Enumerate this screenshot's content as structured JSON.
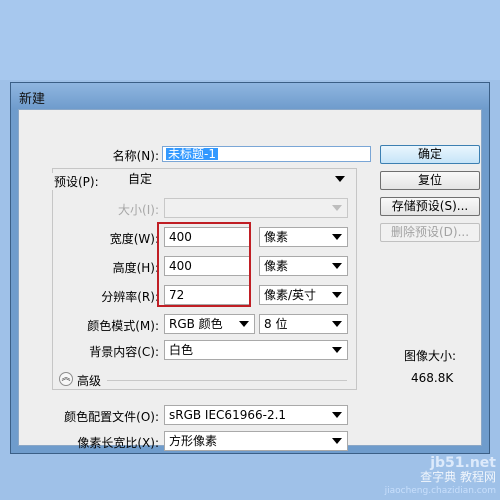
{
  "dialog": {
    "title": "新建",
    "name_label": "名称(N):",
    "name_value": "未标题-1",
    "preset_label": "预设(P):",
    "preset_value": "自定",
    "size_label": "大小(I):",
    "width_label": "宽度(W):",
    "width_value": "400",
    "width_unit": "像素",
    "height_label": "高度(H):",
    "height_value": "400",
    "height_unit": "像素",
    "resolution_label": "分辨率(R):",
    "resolution_value": "72",
    "resolution_unit": "像素/英寸",
    "color_mode_label": "颜色模式(M):",
    "color_mode_value": "RGB 颜色",
    "bit_depth_value": "8 位",
    "background_label": "背景内容(C):",
    "background_value": "白色",
    "advanced_label": "高级",
    "color_profile_label": "颜色配置文件(O):",
    "color_profile_value": "sRGB IEC61966-2.1",
    "pixel_aspect_label": "像素长宽比(X):",
    "pixel_aspect_value": "方形像素"
  },
  "buttons": {
    "ok": "确定",
    "reset": "复位",
    "save_preset": "存储预设(S)...",
    "delete_preset": "删除预设(D)..."
  },
  "image_size": {
    "label": "图像大小:",
    "value": "468.8K"
  },
  "watermark": {
    "line1": "jb51.net",
    "line2": "查字典 教程网",
    "line3": "jiaocheng.chazidian.com"
  },
  "colors": {
    "ok_button": "#c6e4f8",
    "highlight_box": "#c01e24",
    "selection": "#3399ff"
  }
}
